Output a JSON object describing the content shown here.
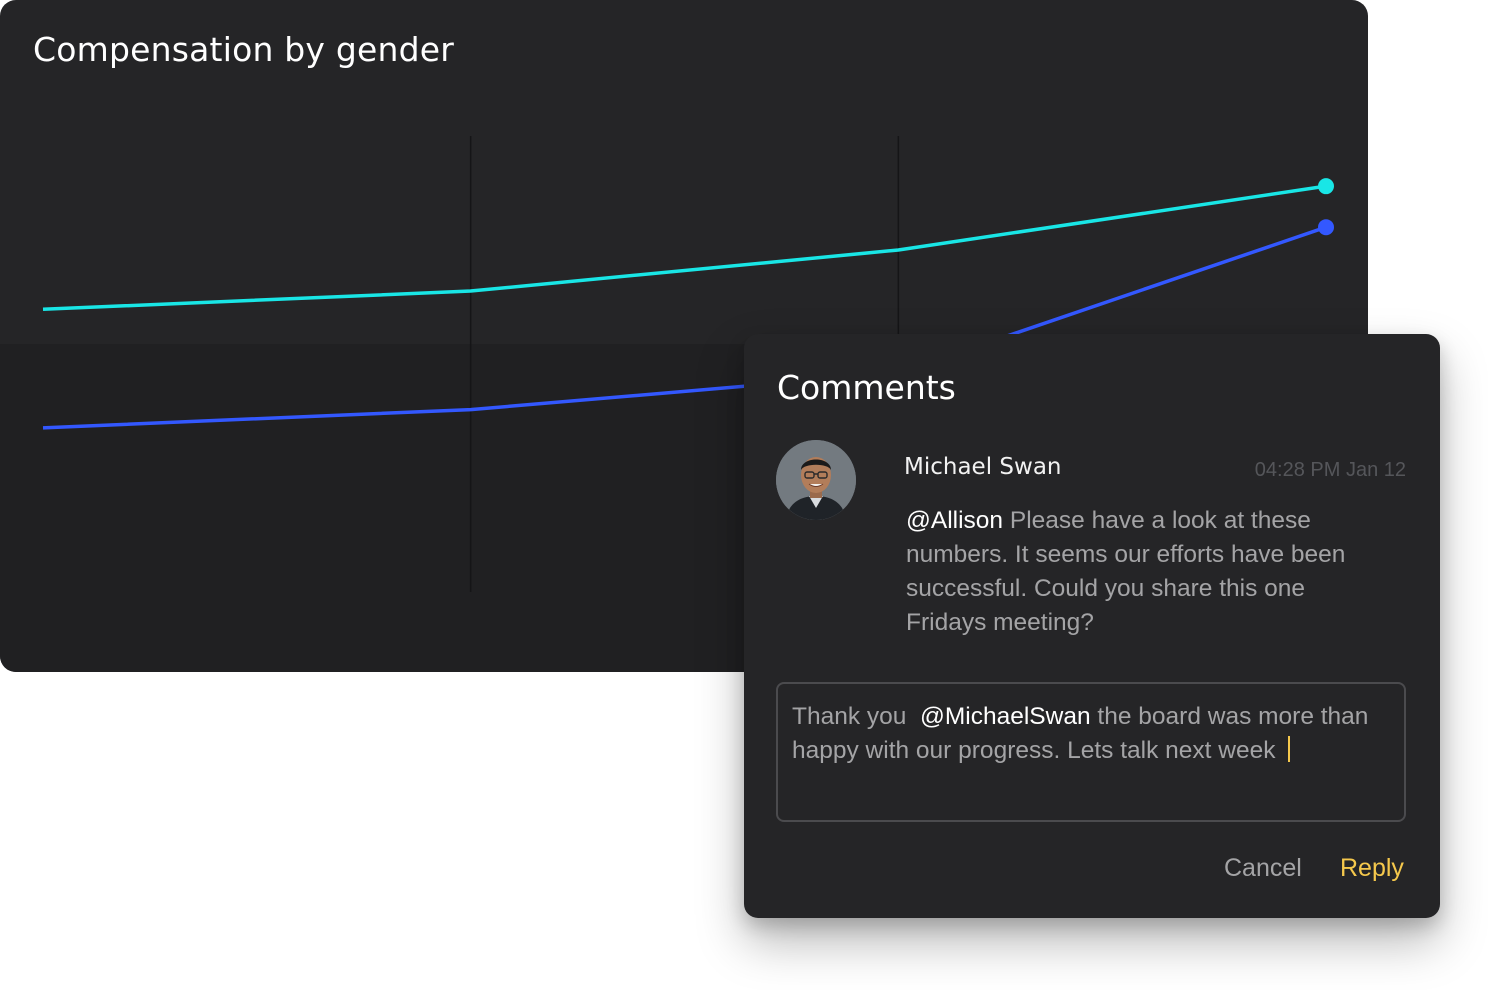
{
  "chart": {
    "title": "Compensation by gender"
  },
  "chart_data": {
    "type": "line",
    "title": "Compensation by gender",
    "xlabel": "",
    "ylabel": "",
    "x": [
      0,
      1,
      2,
      3
    ],
    "ylim": [
      0,
      100
    ],
    "grid": "vertical",
    "series": [
      {
        "color": "#19e6e6",
        "values": [
          62,
          66,
          75,
          89
        ]
      },
      {
        "color": "#3358ff",
        "values": [
          36,
          40,
          48,
          80
        ]
      }
    ]
  },
  "comments": {
    "title": "Comments",
    "author": "Michael Swan",
    "timestamp": "04:28 PM Jan 12",
    "mention": "@Allison",
    "body": " Please have a look at these numbers. It seems our efforts have been successful. Could you share this one Fridays meeting?",
    "reply": {
      "prefix": "Thank you  ",
      "mention": "@MichaelSwan",
      "text": " the board was more than happy with our progress. Lets talk next week "
    },
    "cancel_label": "Cancel",
    "reply_label": "Reply"
  },
  "colors": {
    "panel": "#252527",
    "accent": "#f5c84c",
    "series_1": "#19e6e6",
    "series_2": "#3358ff"
  }
}
